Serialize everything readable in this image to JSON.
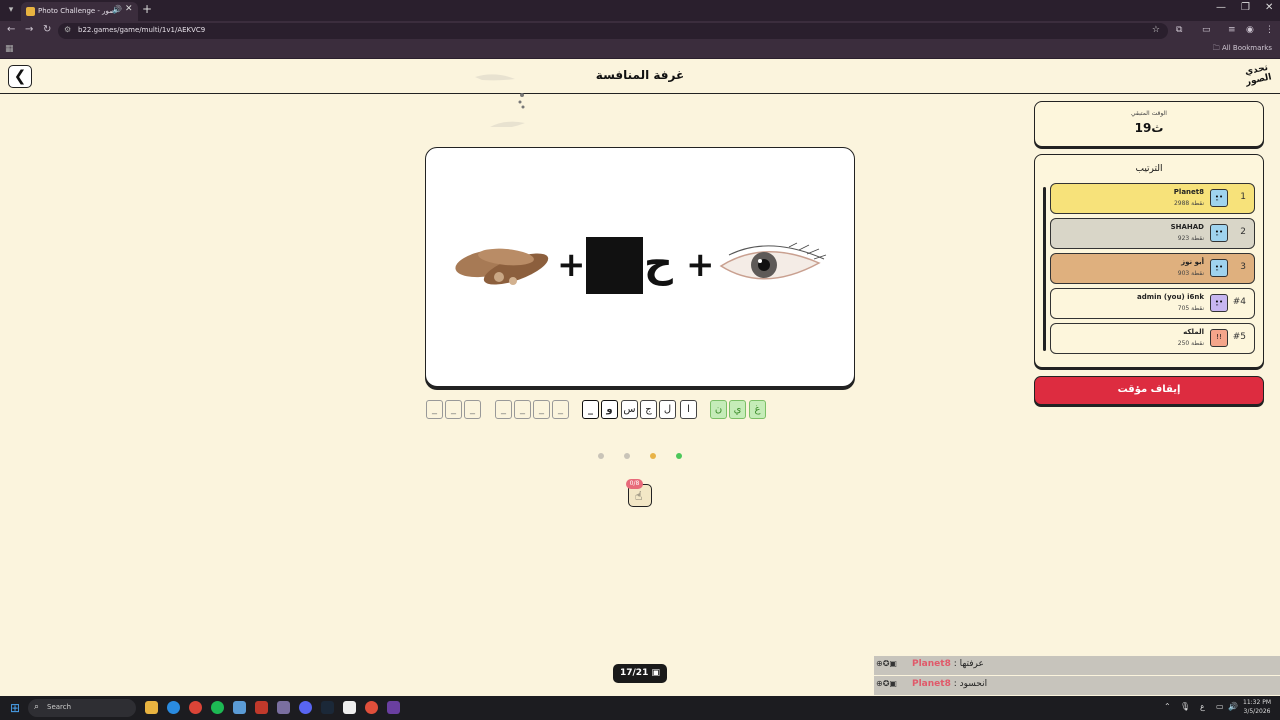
{
  "browser": {
    "tab_title": "Photo Challenge - تحدي الصور",
    "new_tab_icon": "+",
    "url": "b22.games/game/multi/1v1/AEKVC9",
    "all_bookmarks": "All Bookmarks"
  },
  "header": {
    "title": "غرفة المنافسة",
    "logo_text": "تحدي الصور"
  },
  "puzzle": {
    "arabic_char": "ح",
    "plus": "+",
    "slots_group1": [
      "_",
      "_",
      "_"
    ],
    "slots_group2": [
      "_",
      "_",
      "_",
      "_"
    ],
    "slots_group3": [
      "_",
      "و",
      "س",
      "ج",
      "ل",
      "ا"
    ],
    "slots_group4": [
      "ن",
      "ي",
      "غ"
    ],
    "dots_colors": [
      "#c9c4b8",
      "#c9c4b8",
      "#e8b347",
      "#4cc75a"
    ],
    "hint_badge": "0/8"
  },
  "sidebar": {
    "timer_label": "الوقت المتبقي",
    "timer_value": "19ث",
    "ranking_title": "الترتيب",
    "players": [
      {
        "rank": "1",
        "name": "Planet8",
        "score": "2988 نقطة",
        "color": "#f7e27a",
        "avatar": "•͈•"
      },
      {
        "rank": "2",
        "name": "SHAHAD",
        "score": "923 نقطة",
        "color": "#d9d6c8",
        "avatar": "•͈•"
      },
      {
        "rank": "3",
        "name": "أبو نوز",
        "score": "903 نقطة",
        "color": "#dfb07e",
        "avatar": "•͈•"
      },
      {
        "rank": "#4",
        "name": "admin (you) i6nk",
        "score": "705 نقطة",
        "color": "#fdf6dc",
        "avatar": "•͈•"
      },
      {
        "rank": "#5",
        "name": "الملكه",
        "score": "250 نقطة",
        "color": "#fdf6dc",
        "avatar": "!!"
      }
    ],
    "stop_button": "إيقاف مؤقت"
  },
  "footer": {
    "counter": "17/21",
    "chat": [
      {
        "name": "Planet8",
        "text": ": عرفتها"
      },
      {
        "name": "Planet8",
        "text": ": انحسود"
      }
    ]
  },
  "taskbar": {
    "search": "Search",
    "time": "11:32 PM",
    "date": "3/5/2026"
  }
}
